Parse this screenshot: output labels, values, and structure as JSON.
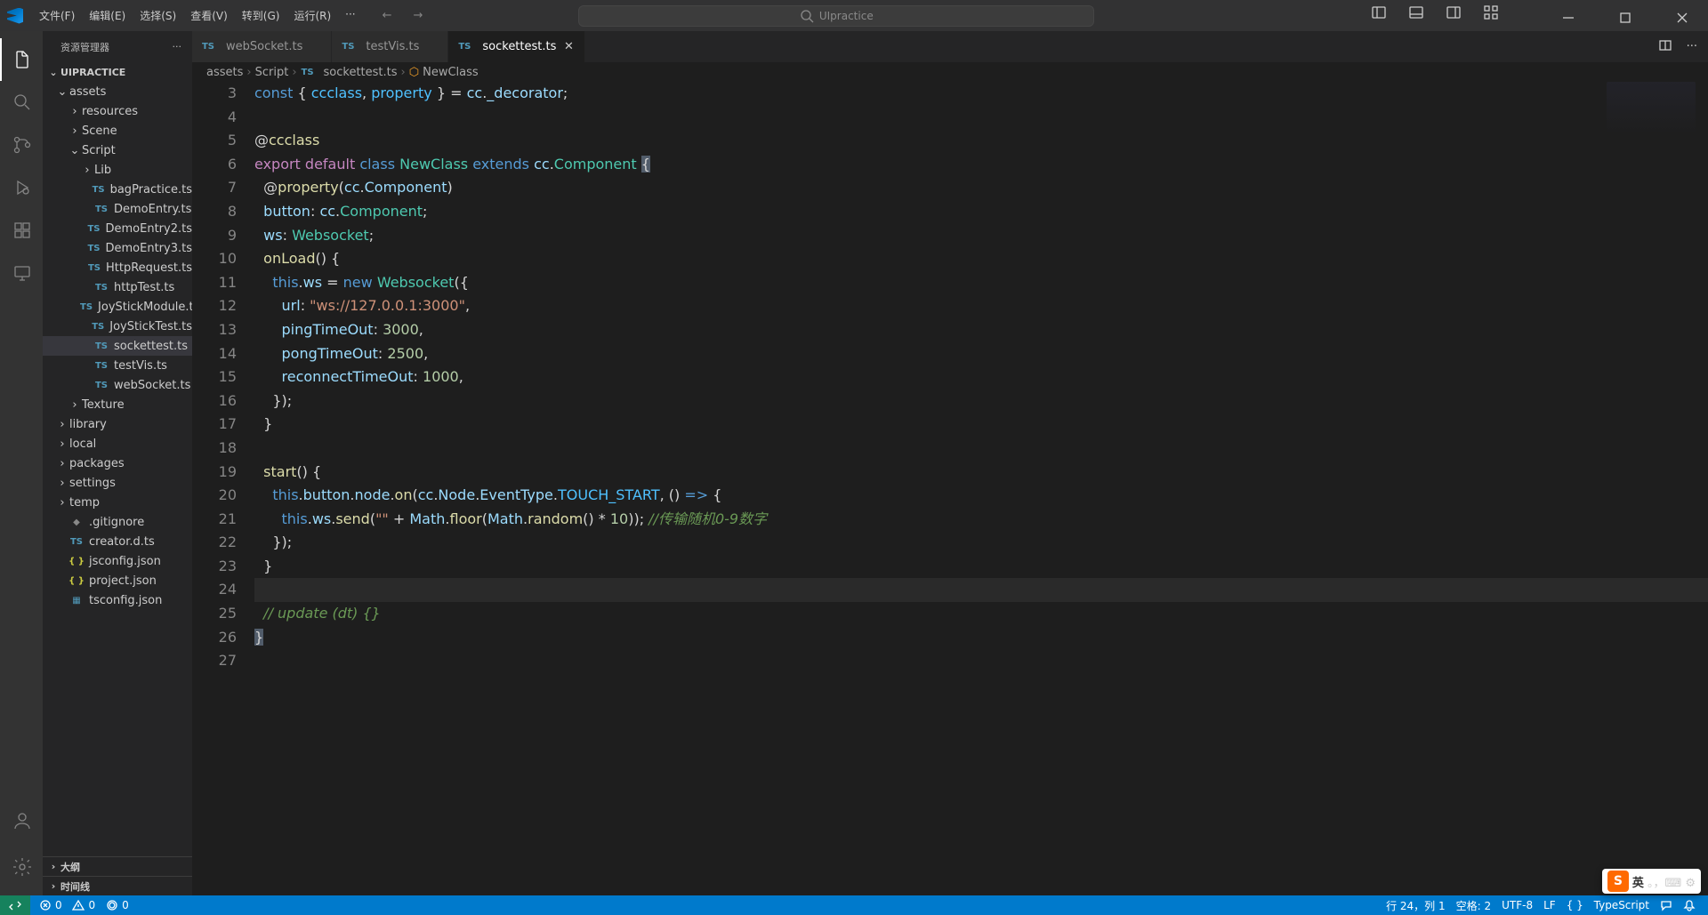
{
  "title": "UIpractice",
  "menu": [
    "文件(F)",
    "编辑(E)",
    "选择(S)",
    "查看(V)",
    "转到(G)",
    "运行(R)",
    "···"
  ],
  "sidebar": {
    "title": "资源管理器",
    "project": "UIPRACTICE",
    "tree": [
      {
        "l": "assets",
        "d": 1,
        "t": "folder",
        "open": true
      },
      {
        "l": "resources",
        "d": 2,
        "t": "folder"
      },
      {
        "l": "Scene",
        "d": 2,
        "t": "folder"
      },
      {
        "l": "Script",
        "d": 2,
        "t": "folder",
        "open": true
      },
      {
        "l": "Lib",
        "d": 3,
        "t": "folder"
      },
      {
        "l": "bagPractice.ts",
        "d": 3,
        "t": "ts"
      },
      {
        "l": "DemoEntry.ts",
        "d": 3,
        "t": "ts"
      },
      {
        "l": "DemoEntry2.ts",
        "d": 3,
        "t": "ts"
      },
      {
        "l": "DemoEntry3.ts",
        "d": 3,
        "t": "ts"
      },
      {
        "l": "HttpRequest.ts",
        "d": 3,
        "t": "ts"
      },
      {
        "l": "httpTest.ts",
        "d": 3,
        "t": "ts"
      },
      {
        "l": "JoyStickModule.ts",
        "d": 3,
        "t": "ts"
      },
      {
        "l": "JoyStickTest.ts",
        "d": 3,
        "t": "ts"
      },
      {
        "l": "sockettest.ts",
        "d": 3,
        "t": "ts",
        "active": true
      },
      {
        "l": "testVis.ts",
        "d": 3,
        "t": "ts"
      },
      {
        "l": "webSocket.ts",
        "d": 3,
        "t": "ts"
      },
      {
        "l": "Texture",
        "d": 2,
        "t": "folder"
      },
      {
        "l": "library",
        "d": 1,
        "t": "folder"
      },
      {
        "l": "local",
        "d": 1,
        "t": "folder"
      },
      {
        "l": "packages",
        "d": 1,
        "t": "folder"
      },
      {
        "l": "settings",
        "d": 1,
        "t": "folder"
      },
      {
        "l": "temp",
        "d": 1,
        "t": "folder"
      },
      {
        "l": ".gitignore",
        "d": 1,
        "t": "file"
      },
      {
        "l": "creator.d.ts",
        "d": 1,
        "t": "ts"
      },
      {
        "l": "jsconfig.json",
        "d": 1,
        "t": "json"
      },
      {
        "l": "project.json",
        "d": 1,
        "t": "json"
      },
      {
        "l": "tsconfig.json",
        "d": 1,
        "t": "json2"
      }
    ],
    "outline": "大纲",
    "timeline": "时间线"
  },
  "tabs": [
    {
      "l": "webSocket.ts"
    },
    {
      "l": "testVis.ts"
    },
    {
      "l": "sockettest.ts",
      "active": true
    }
  ],
  "breadcrumb": [
    "assets",
    "Script",
    "sockettest.ts",
    "NewClass"
  ],
  "code_lines": [
    {
      "n": 3,
      "h": "<span class='kw'>const</span> <span class='pn'>{</span> <span class='var'>ccclass</span><span class='pn'>,</span> <span class='var'>property</span> <span class='pn'>}</span> <span class='pn'>=</span> <span class='prop'>cc</span><span class='pn'>.</span><span class='prop'>_decorator</span><span class='pn'>;</span>"
    },
    {
      "n": 4,
      "h": ""
    },
    {
      "n": 5,
      "h": "<span class='pn'>@</span><span class='fn'>ccclass</span>"
    },
    {
      "n": 6,
      "h": "<span class='kw2'>export</span> <span class='kw2'>default</span> <span class='kw'>class</span> <span class='cls'>NewClass</span> <span class='kw'>extends</span> <span class='prop'>cc</span><span class='pn'>.</span><span class='cls'>Component</span> <span class='pn hl'>{</span>"
    },
    {
      "n": 7,
      "h": "  <span class='pn'>@</span><span class='fn'>property</span><span class='pn'>(</span><span class='prop'>cc</span><span class='pn'>.</span><span class='prop'>Component</span><span class='pn'>)</span>"
    },
    {
      "n": 8,
      "h": "  <span class='prop'>button</span><span class='pn'>:</span> <span class='prop'>cc</span><span class='pn'>.</span><span class='cls'>Component</span><span class='pn'>;</span>"
    },
    {
      "n": 9,
      "h": "  <span class='prop'>ws</span><span class='pn'>:</span> <span class='cls'>Websocket</span><span class='pn'>;</span>"
    },
    {
      "n": 10,
      "h": "  <span class='fn'>onLoad</span><span class='pn'>() {</span>"
    },
    {
      "n": 11,
      "h": "    <span class='kw'>this</span><span class='pn'>.</span><span class='prop'>ws</span> <span class='pn'>=</span> <span class='kw'>new</span> <span class='cls'>Websocket</span><span class='pn'>({</span>"
    },
    {
      "n": 12,
      "h": "      <span class='prop'>url</span><span class='pn'>:</span> <span class='str'>\"ws://127.0.0.1:3000\"</span><span class='pn'>,</span>"
    },
    {
      "n": 13,
      "h": "      <span class='prop'>pingTimeOut</span><span class='pn'>:</span> <span class='num'>3000</span><span class='pn'>,</span>"
    },
    {
      "n": 14,
      "h": "      <span class='prop'>pongTimeOut</span><span class='pn'>:</span> <span class='num'>2500</span><span class='pn'>,</span>"
    },
    {
      "n": 15,
      "h": "      <span class='prop'>reconnectTimeOut</span><span class='pn'>:</span> <span class='num'>1000</span><span class='pn'>,</span>"
    },
    {
      "n": 16,
      "h": "    <span class='pn'>});</span>"
    },
    {
      "n": 17,
      "h": "  <span class='pn'>}</span>"
    },
    {
      "n": 18,
      "h": ""
    },
    {
      "n": 19,
      "h": "  <span class='fn'>start</span><span class='pn'>() {</span>"
    },
    {
      "n": 20,
      "h": "    <span class='kw'>this</span><span class='pn'>.</span><span class='prop'>button</span><span class='pn'>.</span><span class='prop'>node</span><span class='pn'>.</span><span class='fn'>on</span><span class='pn'>(</span><span class='prop'>cc</span><span class='pn'>.</span><span class='prop'>Node</span><span class='pn'>.</span><span class='prop'>EventType</span><span class='pn'>.</span><span class='var'>TOUCH_START</span><span class='pn'>, () </span><span class='kw'>=&gt;</span><span class='pn'> {</span>"
    },
    {
      "n": 21,
      "h": "      <span class='kw'>this</span><span class='pn'>.</span><span class='prop'>ws</span><span class='pn'>.</span><span class='fn'>send</span><span class='pn'>(</span><span class='str'>\"\"</span> <span class='pn'>+</span> <span class='prop'>Math</span><span class='pn'>.</span><span class='fn'>floor</span><span class='pn'>(</span><span class='prop'>Math</span><span class='pn'>.</span><span class='fn'>random</span><span class='pn'>() *</span> <span class='num'>10</span><span class='pn'>));</span> <span class='cmt'>//传输随机0-9数字</span>"
    },
    {
      "n": 22,
      "h": "    <span class='pn'>});</span>"
    },
    {
      "n": 23,
      "h": "  <span class='pn'>}</span>"
    },
    {
      "n": 24,
      "h": "",
      "cur": true
    },
    {
      "n": 25,
      "h": "  <span class='cmt'>// update (dt) {}</span>"
    },
    {
      "n": 26,
      "h": "<span class='pn hl'>}</span>"
    },
    {
      "n": 27,
      "h": ""
    }
  ],
  "status": {
    "errors": "0",
    "warnings": "0",
    "ports": "0",
    "ln": "行 24，列 1",
    "spaces": "空格: 2",
    "enc": "UTF-8",
    "eol": "LF",
    "lang": "TypeScript"
  },
  "ime": {
    "ch": "英",
    "txt": "。，⌨ ⚙"
  }
}
